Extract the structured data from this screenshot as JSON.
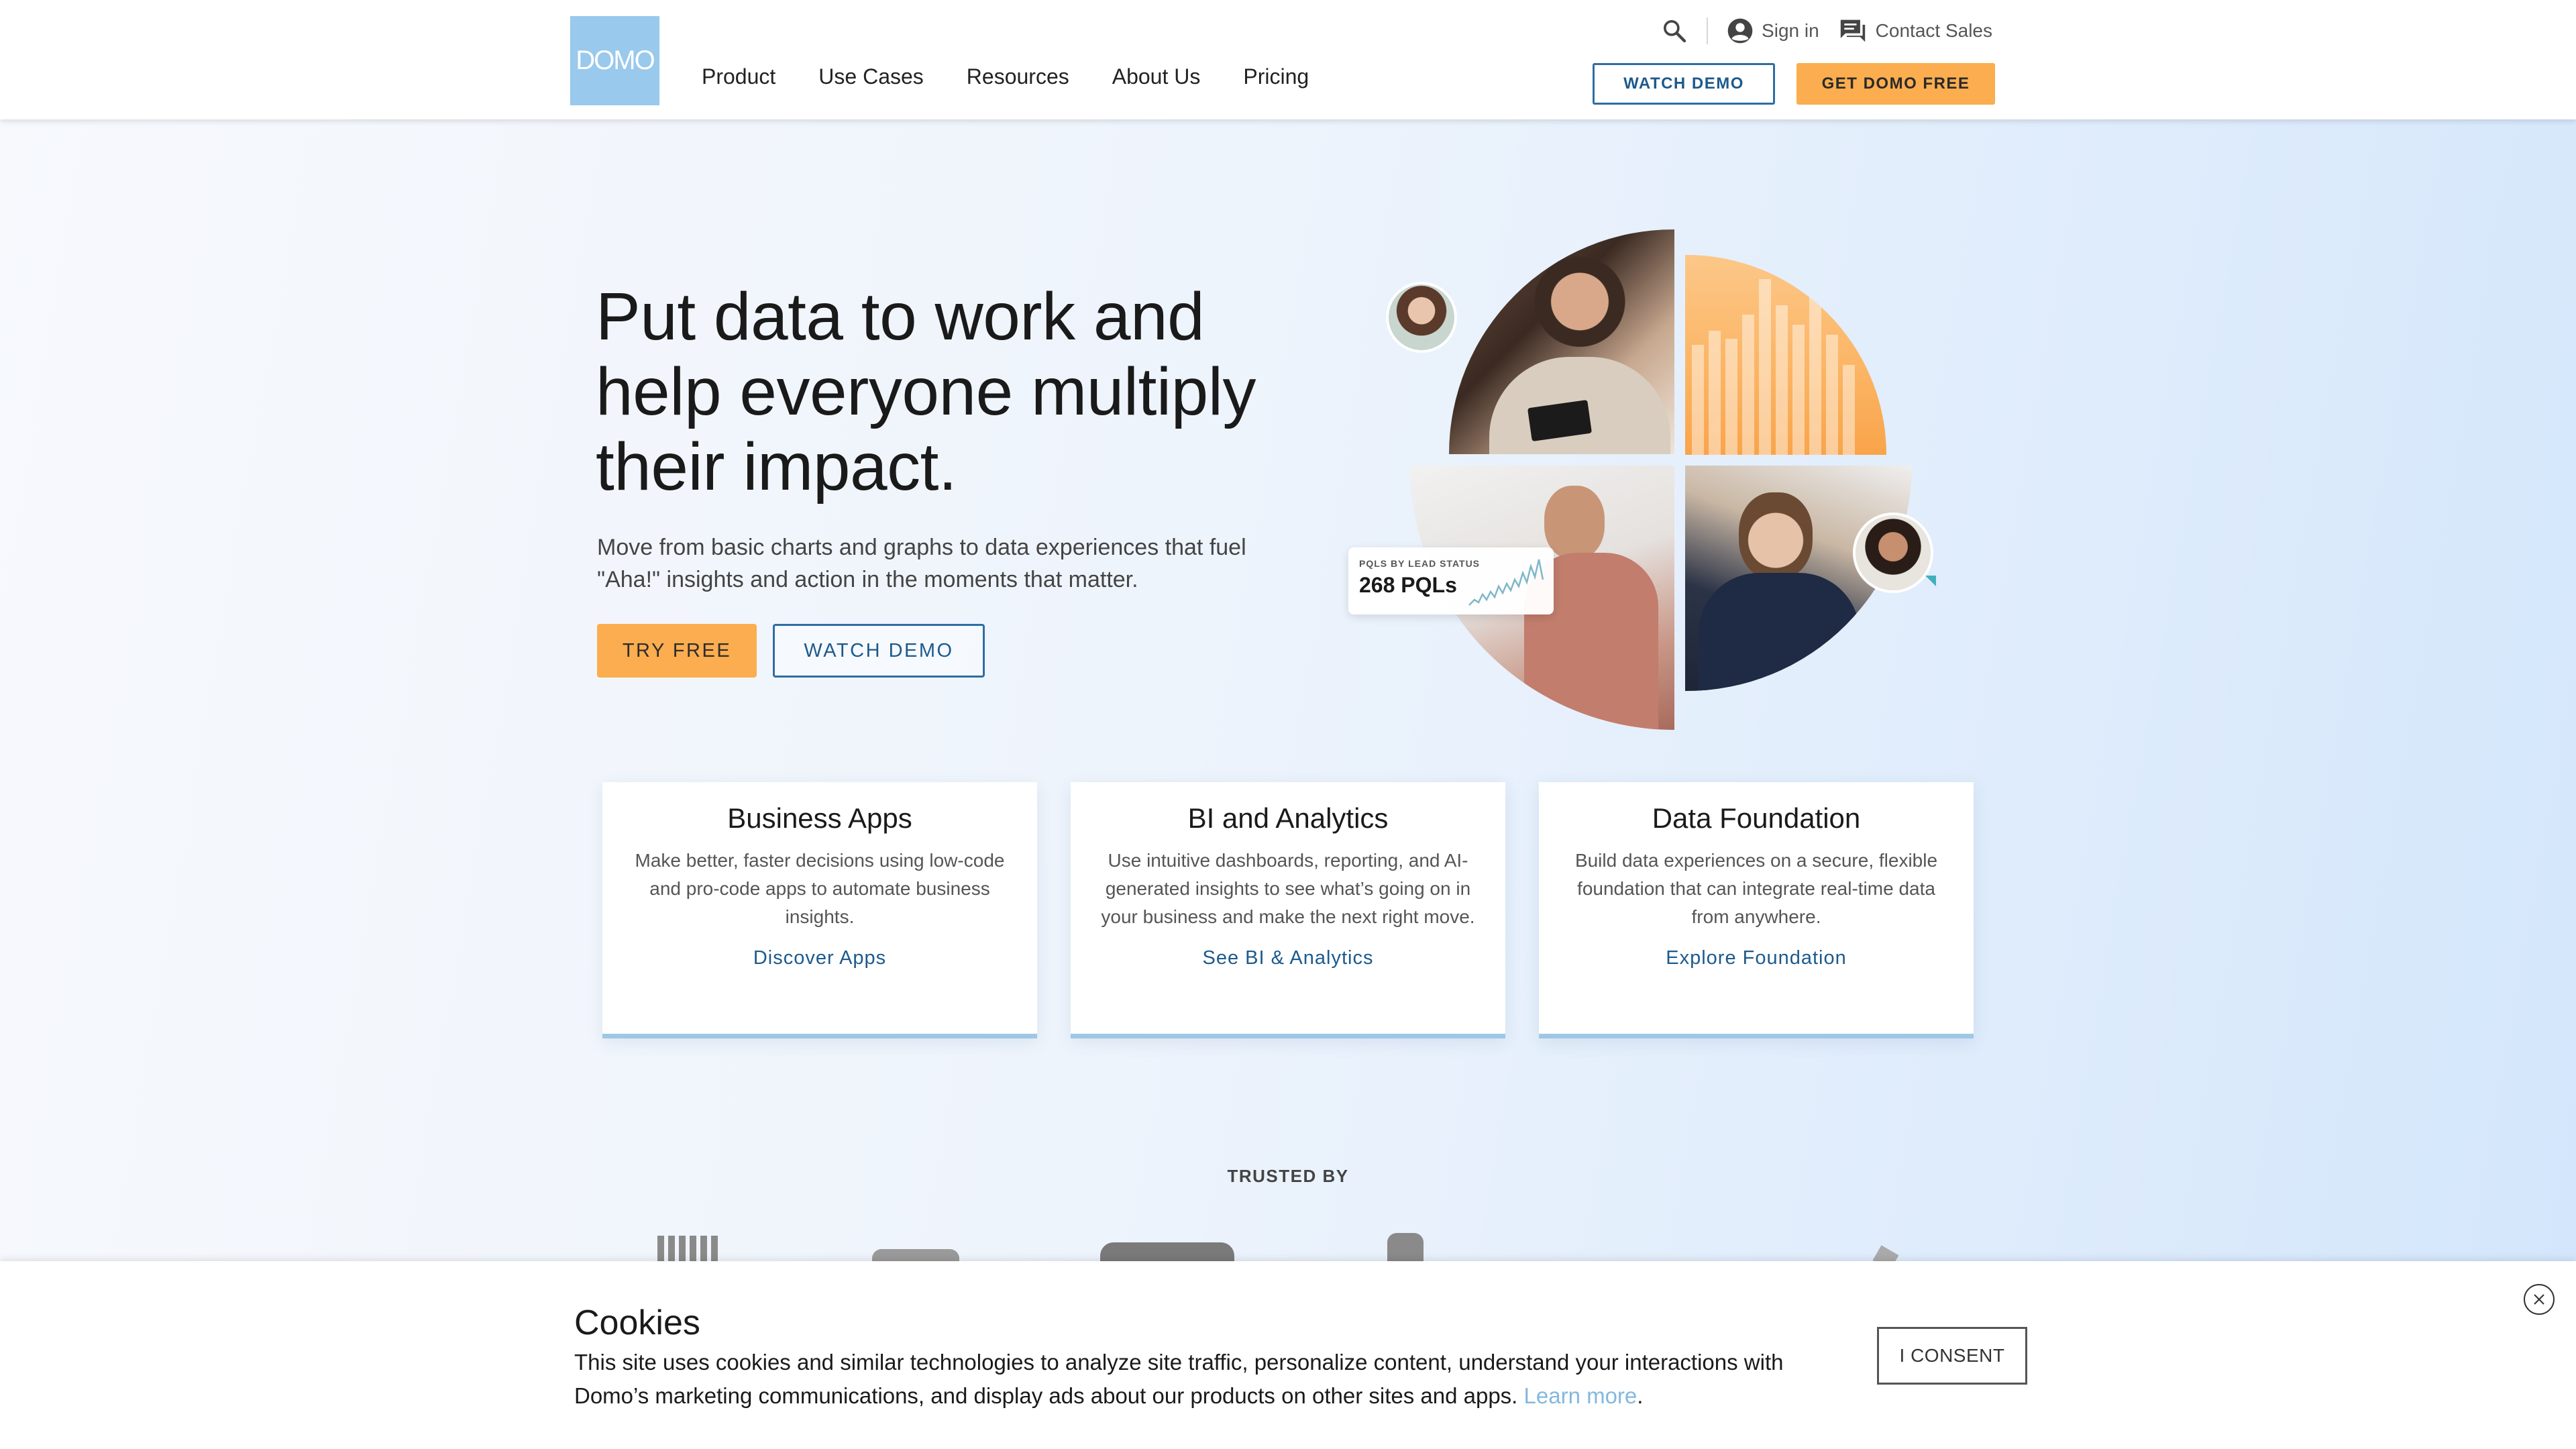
{
  "header": {
    "logo_text": "DOMO",
    "nav": [
      "Product",
      "Use Cases",
      "Resources",
      "About Us",
      "Pricing"
    ],
    "util": {
      "sign_in": "Sign in",
      "contact_sales": "Contact Sales"
    },
    "watch_demo": "WATCH DEMO",
    "get_free": "GET DOMO FREE"
  },
  "hero": {
    "title_lines": [
      "Put data to work and",
      "help everyone multiply",
      "their impact."
    ],
    "subtitle_lines": [
      "Move from basic charts and graphs to data experiences that fuel",
      "\"Aha!\" insights and action in the moments that matter."
    ],
    "try_free": "TRY FREE",
    "watch_demo": "WATCH DEMO",
    "pql_label": "PQLS BY LEAD STATUS",
    "pql_value": "268 PQLs"
  },
  "cards": [
    {
      "title": "Business Apps",
      "desc": "Make better, faster decisions using low-code and pro-code apps to automate business insights.",
      "link": "Discover Apps"
    },
    {
      "title": "BI and Analytics",
      "desc": "Use intuitive dashboards, reporting, and AI-generated insights to see what’s going on in your business and make the next right move.",
      "link": "See BI & Analytics"
    },
    {
      "title": "Data Foundation",
      "desc": "Build data experiences on a secure, flexible foundation that can integrate real-time data from anywhere.",
      "link": "Explore Foundation"
    }
  ],
  "trusted": {
    "label": "TRUSTED BY"
  },
  "cookie": {
    "title": "Cookies",
    "text": "This site uses cookies and similar technologies to analyze site traffic, personalize content, understand your interactions with Domo’s marketing communications, and display ads about our products on other sites and apps.",
    "link": "Learn more",
    "consent": "I CONSENT"
  },
  "colors": {
    "accent_orange": "#fbad4f",
    "accent_blue": "#1d5a8c",
    "logo_blue": "#99c9ec"
  }
}
